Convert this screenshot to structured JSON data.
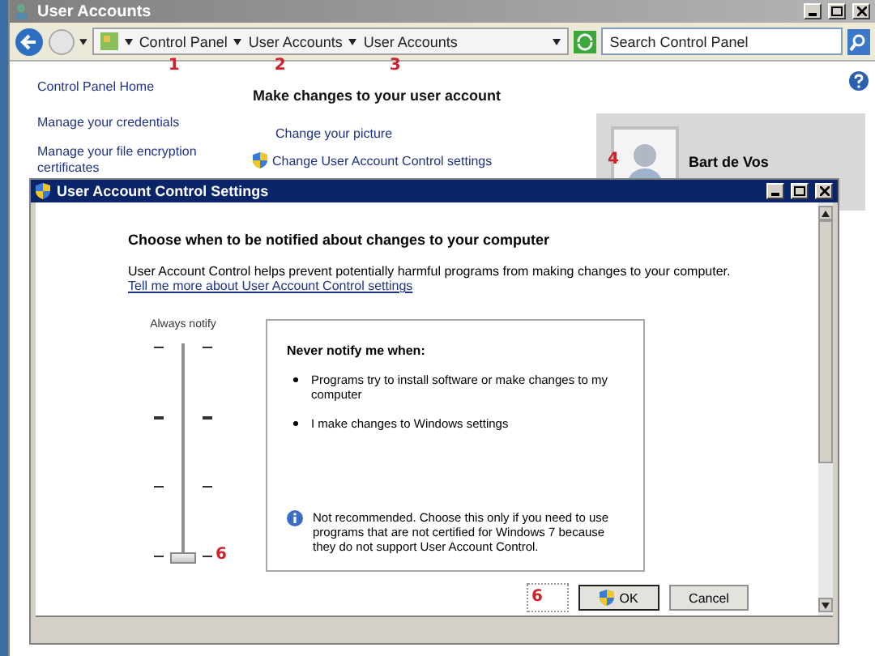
{
  "window": {
    "title": "User Accounts"
  },
  "address_bar": {
    "segments": [
      {
        "label": "Control Panel",
        "annotation": "1"
      },
      {
        "label": "User Accounts",
        "annotation": "2"
      },
      {
        "label": "User Accounts",
        "annotation": "3"
      }
    ]
  },
  "search": {
    "placeholder": "Search Control Panel"
  },
  "sidebar": {
    "items": [
      "Control Panel Home",
      "Manage your credentials",
      "Manage your file encryption certificates"
    ]
  },
  "main": {
    "heading": "Make changes to your user account",
    "tasks": [
      {
        "label": "Change your picture",
        "kind": "plain"
      },
      {
        "label": "Change User Account Control settings",
        "kind": "shield",
        "annotation": "4"
      }
    ]
  },
  "user": {
    "name": "Bart de Vos"
  },
  "dialog": {
    "title": "User Account Control Settings",
    "heading": "Choose when to be notified about changes to your computer",
    "description": "User Account Control helps prevent potentially harmful programs from making changes to your computer.",
    "link": "Tell me more about User Account Control settings",
    "slider": {
      "top_label": "Always notify",
      "level": 0,
      "annotation": "6"
    },
    "info": {
      "heading": "Never notify me when:",
      "bullets": [
        "Programs try to install software or make changes to my computer",
        "I make changes to Windows settings"
      ],
      "note": "Not recommended. Choose this only if you need to use programs that are not certified for Windows 7 because they do not support User Account Control."
    },
    "buttons_annotation": "6",
    "buttons": [
      {
        "label": "OK",
        "kind": "shield",
        "default": true
      },
      {
        "label": "Cancel",
        "kind": "plain",
        "default": false
      }
    ]
  }
}
